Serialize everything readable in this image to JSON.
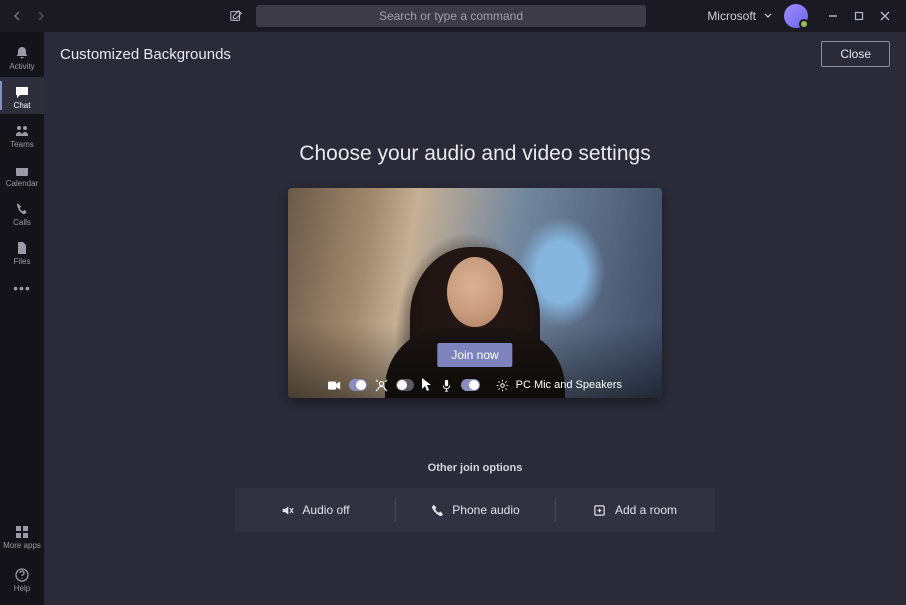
{
  "titlebar": {
    "search_placeholder": "Search or type a command",
    "org_label": "Microsoft"
  },
  "rail": {
    "activity": "Activity",
    "chat": "Chat",
    "teams": "Teams",
    "calendar": "Calendar",
    "calls": "Calls",
    "files": "Files",
    "more_apps": "More apps",
    "help": "Help"
  },
  "header": {
    "title": "Customized Backgrounds",
    "close": "Close"
  },
  "prejoin": {
    "heading": "Choose your audio and video settings",
    "join_label": "Join now",
    "device_label": "PC Mic and Speakers",
    "toggles": {
      "camera_on": true,
      "bgfx_on": false,
      "mic_on": true
    },
    "other_heading": "Other join options",
    "options": {
      "audio_off": "Audio off",
      "phone_audio": "Phone audio",
      "add_room": "Add a room"
    }
  }
}
